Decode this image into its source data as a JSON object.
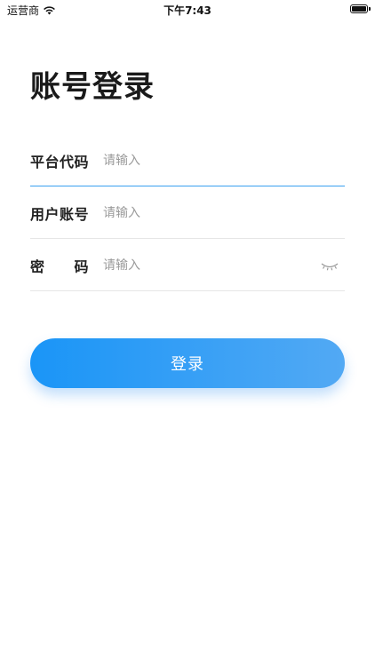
{
  "status_bar": {
    "carrier": "运营商",
    "time": "下午7:43",
    "wifi_icon": "wifi-icon",
    "battery_icon": "battery-icon"
  },
  "page": {
    "title": "账号登录"
  },
  "form": {
    "platform_code": {
      "label": "平台代码",
      "placeholder": "请输入",
      "value": ""
    },
    "account": {
      "label": "用户账号",
      "placeholder": "请输入",
      "value": ""
    },
    "password": {
      "label_char_1": "密",
      "label_char_2": "码",
      "placeholder": "请输入",
      "value": "",
      "toggle_icon": "eye-closed-icon"
    }
  },
  "actions": {
    "login_label": "登录"
  },
  "colors": {
    "accent": "#3aa0f0",
    "button_gradient_start": "#1a95f7",
    "button_gradient_end": "#52a9f4",
    "placeholder": "#9a9a9a",
    "divider": "#e6e6e6"
  }
}
